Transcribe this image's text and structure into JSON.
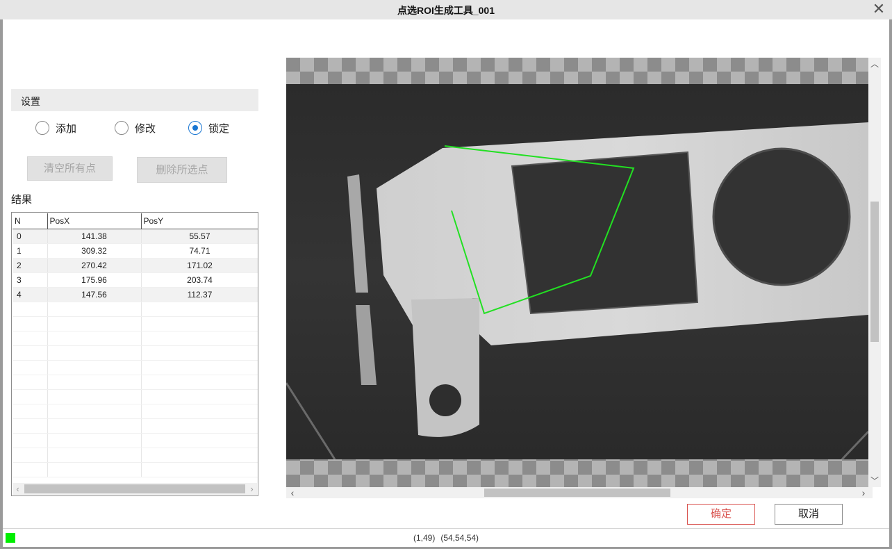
{
  "window": {
    "title": "点选ROI生成工具_001"
  },
  "settings": {
    "header": "设置",
    "modes": [
      {
        "label": "添加",
        "selected": false
      },
      {
        "label": "修改",
        "selected": false
      },
      {
        "label": "锁定",
        "selected": true
      }
    ],
    "clear_all_label": "清空所有点",
    "delete_selected_label": "删除所选点"
  },
  "results": {
    "label": "结果",
    "columns": [
      "N",
      "PosX",
      "PosY"
    ],
    "rows": [
      [
        "0",
        "141.38",
        "55.57"
      ],
      [
        "1",
        "309.32",
        "74.71"
      ],
      [
        "2",
        "270.42",
        "171.02"
      ],
      [
        "3",
        "175.96",
        "203.74"
      ],
      [
        "4",
        "147.56",
        "112.37"
      ]
    ]
  },
  "actions": {
    "ok_label": "确定",
    "cancel_label": "取消"
  },
  "status": {
    "coords": "(1,49)",
    "rgb": "(54,54,54)",
    "indicator_color": "#00ee00"
  },
  "roi": {
    "line_color": "#22e022"
  }
}
